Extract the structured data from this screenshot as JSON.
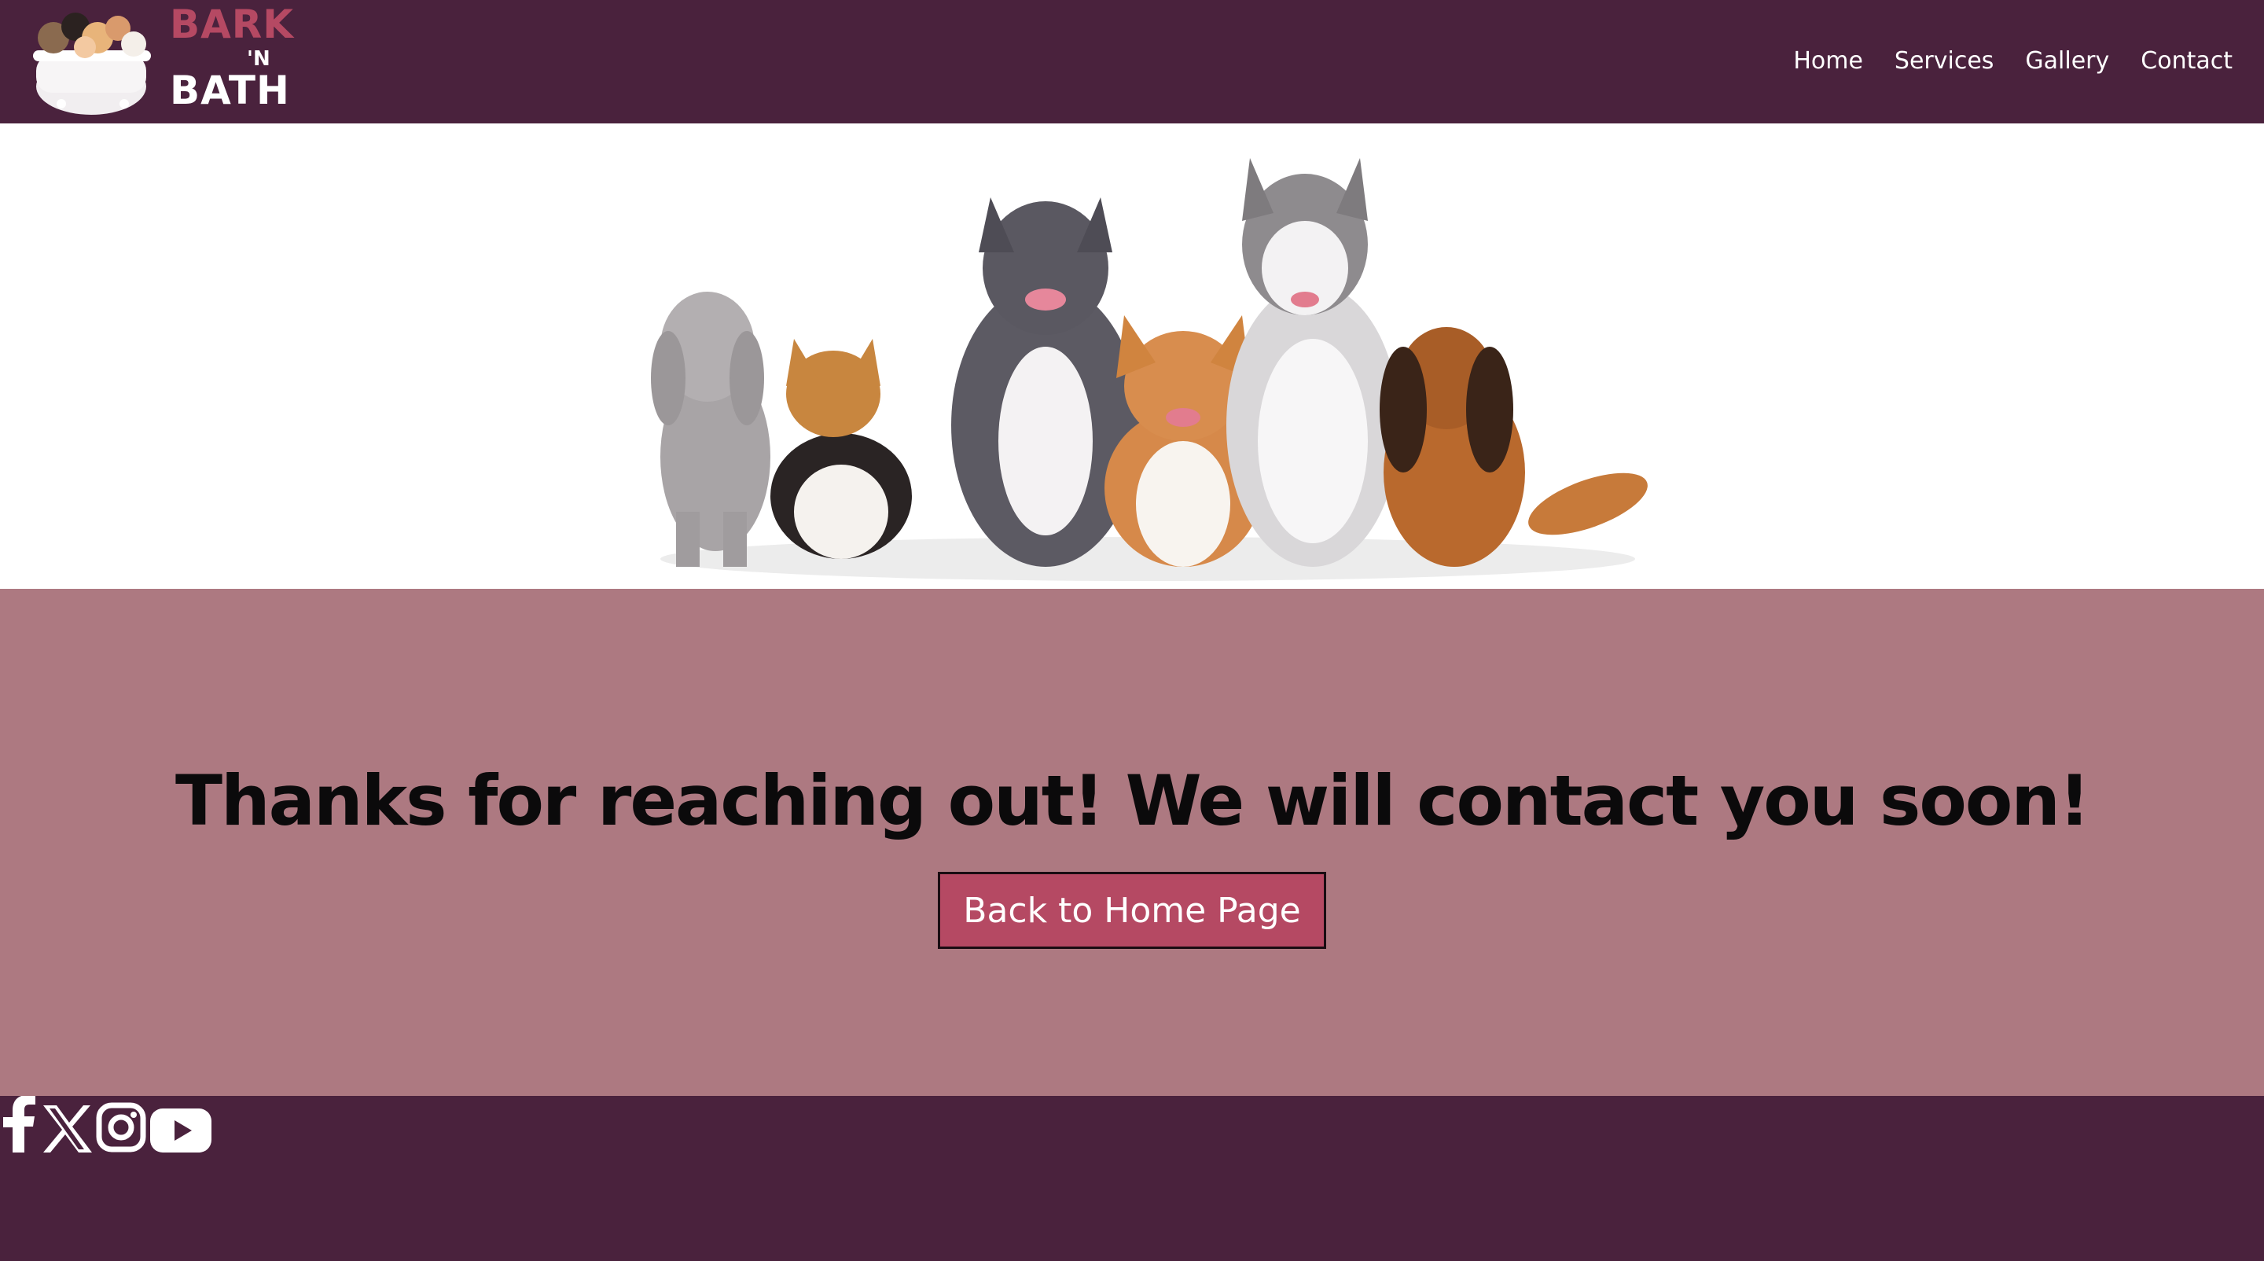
{
  "header": {
    "logo": {
      "line1": "BARK",
      "line2": "'N",
      "line3": "BATH"
    },
    "nav": [
      {
        "label": "Home"
      },
      {
        "label": "Services"
      },
      {
        "label": "Gallery"
      },
      {
        "label": "Contact"
      }
    ]
  },
  "hero": {
    "image": "group-of-six-dogs-photo"
  },
  "main": {
    "title": "Thanks for reaching out! We will contact you soon!",
    "button_label": "Back to Home Page"
  },
  "footer": {
    "social": [
      {
        "icon": "facebook-icon"
      },
      {
        "icon": "x-twitter-icon"
      },
      {
        "icon": "instagram-icon"
      },
      {
        "icon": "youtube-icon"
      }
    ]
  },
  "colors": {
    "header_bg": "#4a223d",
    "accent": "#b54963",
    "section_bg": "#ad7981",
    "footer_bg": "#4a223d"
  }
}
